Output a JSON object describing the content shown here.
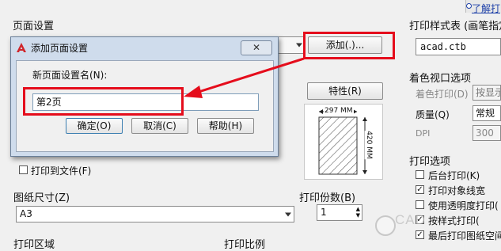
{
  "page_setup": {
    "title": "页面设置",
    "add_button": "添加(.)..."
  },
  "help_link": "了解打",
  "plot_style_table": {
    "title": "打印样式表 (画笔指定",
    "value": "acad.ctb"
  },
  "properties_button": "特性(R)",
  "paper_preview": {
    "width_label": "297 MM",
    "height_label": "420 MM"
  },
  "shaded_viewport": {
    "title": "着色视口选项",
    "shade_plot_label": "着色打印(D)",
    "shade_plot_value": "按显示",
    "quality_label": "质量(Q)",
    "quality_value": "常规",
    "dpi_label": "DPI",
    "dpi_value": "300"
  },
  "plot_to_file": "打印到文件(F)",
  "plot_options": {
    "title": "打印选项",
    "items": [
      {
        "label": "后台打印(K)",
        "checked": false
      },
      {
        "label": "打印对象线宽",
        "checked": true
      },
      {
        "label": "使用透明度打印(",
        "checked": false
      },
      {
        "label": "按样式打印(",
        "checked": true
      },
      {
        "label": "最后打印图纸空间",
        "checked": true
      }
    ]
  },
  "paper_size": {
    "title": "图纸尺寸(Z)",
    "value": "A3"
  },
  "copies": {
    "title": "打印份数(B)",
    "value": "1"
  },
  "plot_area": {
    "title": "打印区域"
  },
  "plot_scale": {
    "title": "打印比例"
  },
  "dialog": {
    "title": "添加页面设置",
    "name_label": "新页面设置名(N):",
    "name_value": "第2页",
    "ok_button": "确定(O)",
    "cancel_button": "取消(C)",
    "help_button": "帮助(H)"
  },
  "watermark": "CAD"
}
